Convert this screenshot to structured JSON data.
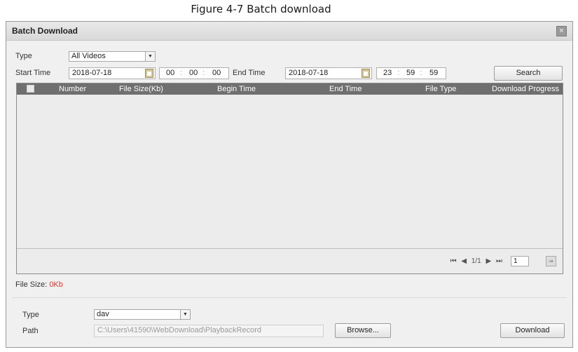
{
  "caption": "Figure 4-7 Batch download",
  "dialog": {
    "title": "Batch Download",
    "close_glyph": "×",
    "type_label": "Type",
    "type_value": "All Videos",
    "start_label": "Start Time",
    "start_date": "2018-07-18",
    "start_time": {
      "h": "00",
      "m": "00",
      "s": "00"
    },
    "end_label": "End Time",
    "end_date": "2018-07-18",
    "end_time": {
      "h": "23",
      "m": "59",
      "s": "59"
    },
    "search_label": "Search",
    "time_separator": ":",
    "table": {
      "columns": [
        "Number",
        "File Size(Kb)",
        "Begin Time",
        "End Time",
        "File Type",
        "Download Progress"
      ],
      "rows": []
    },
    "pager": {
      "first": "⏮",
      "prev": "◀",
      "page_text": "1/1",
      "next": "▶",
      "last": "⏭",
      "page_input": "1",
      "go": "⇒"
    },
    "file_size_label": "File Size:",
    "file_size_value": "0Kb",
    "download_type_label": "Type",
    "download_type_value": "dav",
    "path_label": "Path",
    "path_value": "C:\\Users\\41590\\WebDownload\\PlaybackRecord",
    "browse_label": "Browse...",
    "download_label": "Download",
    "dropdown_arrow": "▼"
  },
  "colors": {
    "header_bg": "#6f6f6f",
    "file_size_value": "#e2332b",
    "dialog_bg": "#f0f0f0"
  }
}
